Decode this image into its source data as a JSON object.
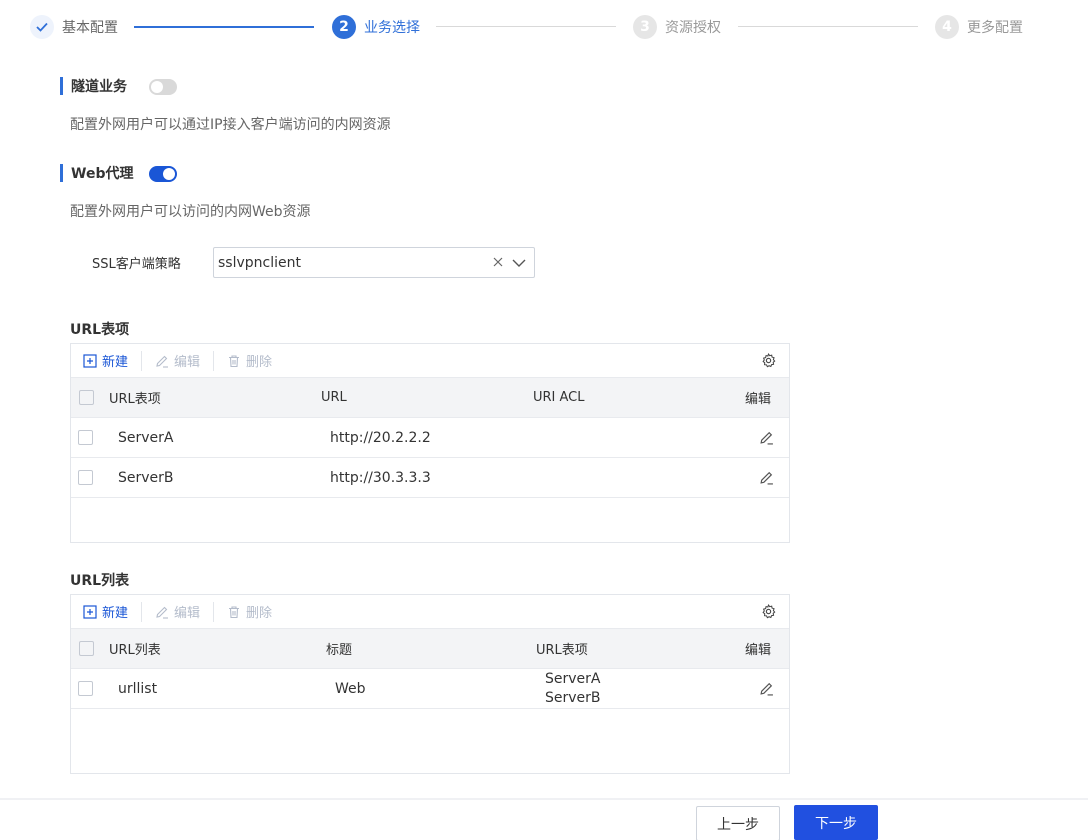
{
  "steps": [
    {
      "number": "✓",
      "label": "基本配置",
      "state": "done"
    },
    {
      "number": "2",
      "label": "业务选择",
      "state": "active"
    },
    {
      "number": "3",
      "label": "资源授权",
      "state": "todo"
    },
    {
      "number": "4",
      "label": "更多配置",
      "state": "todo"
    }
  ],
  "tunnel": {
    "title": "隧道业务",
    "enabled": false,
    "desc": "配置外网用户可以通过IP接入客户端访问的内网资源"
  },
  "web_proxy": {
    "title": "Web代理",
    "enabled": true,
    "desc": "配置外网用户可以访问的内网Web资源"
  },
  "ssl_policy": {
    "label": "SSL客户端策略",
    "value": "sslvpnclient"
  },
  "url_items": {
    "title": "URL表项",
    "toolbar": {
      "new": "新建",
      "edit": "编辑",
      "delete": "删除"
    },
    "columns": [
      "URL表项",
      "URL",
      "URI ACL",
      "编辑"
    ],
    "rows": [
      {
        "name": "ServerA",
        "url": "http://20.2.2.2",
        "acl": ""
      },
      {
        "name": "ServerB",
        "url": "http://30.3.3.3",
        "acl": ""
      }
    ]
  },
  "url_lists": {
    "title": "URL列表",
    "toolbar": {
      "new": "新建",
      "edit": "编辑",
      "delete": "删除"
    },
    "columns": [
      "URL列表",
      "标题",
      "URL表项",
      "编辑"
    ],
    "rows": [
      {
        "name": "urllist",
        "heading": "Web",
        "item1": "ServerA",
        "item2": "ServerB"
      }
    ]
  },
  "footer": {
    "prev": "上一步",
    "next": "下一步"
  },
  "colors": {
    "accent": "#2f6fd8",
    "primary_button": "#2150e0",
    "toggle_on": "#1a56d6"
  }
}
